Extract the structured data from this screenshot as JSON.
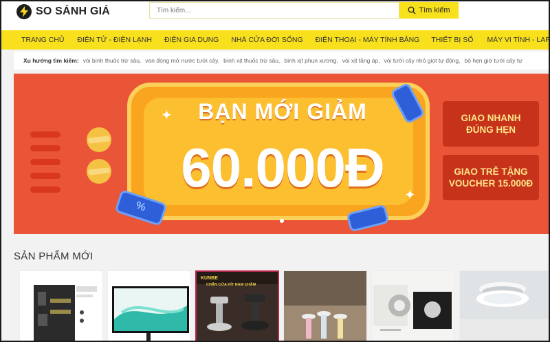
{
  "header": {
    "logo_text": "SO SÁNH GIÁ",
    "search_placeholder": "Tìm kiếm...",
    "search_button": "Tìm kiếm"
  },
  "nav": [
    "TRANG CHỦ",
    "ĐIỆN TỬ - ĐIỆN LẠNH",
    "ĐIỆN GIA DỤNG",
    "NHÀ CỬA ĐỜI SỐNG",
    "ĐIỆN THOẠI - MÁY TÍNH BẢNG",
    "THIẾT BỊ SỐ",
    "MÁY VI TÍNH - LAPTOP"
  ],
  "trends": {
    "label": "Xu hướng tìm kiếm:",
    "items": [
      "vòi bình thuốc trừ sâu,",
      "van đóng mở nước tưới cây,",
      "bình xịt thuốc trừ sâu,",
      "bình xịt phun xương,",
      "vòi xịt tăng áp,",
      "vòi tưới cây nhỏ giọt tự động,",
      "bộ hẹn giờ tưới cây tự"
    ]
  },
  "banner": {
    "title": "BẠN MỚI GIẢM",
    "amount": "60.000Đ",
    "side_top": "GIAO NHANH ĐÚNG HẸN",
    "side_bottom": "GIAO TRỄ TẶNG VOUCHER 15.000Đ",
    "ticket_symbol": "%",
    "colors": {
      "background": "#ea5537",
      "card": "#f9a51f",
      "accent": "#fde68a"
    }
  },
  "products_section": {
    "title": "SẢN PHẨM MỚI",
    "product_count": 6,
    "card2_brand": "KUNBE",
    "card2_caption": "CHẶN CỬA HÍT NAM CHÂM"
  },
  "colors": {
    "brand_yellow": "#f8e01c",
    "header_bg": "#ffffff",
    "page_bg": "#f2f2f2"
  }
}
